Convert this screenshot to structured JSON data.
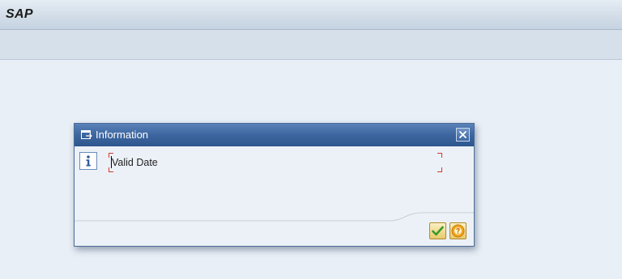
{
  "app": {
    "title": "SAP"
  },
  "dialog": {
    "title": "Information",
    "message": "Valid Date",
    "buttons": {
      "ok_icon": "checkmark-icon",
      "help_icon": "help-icon",
      "close_icon": "close-icon"
    }
  },
  "colors": {
    "header_blue": "#3d66a0",
    "background": "#e9eff6",
    "field_bracket": "#d23a2a",
    "button_gold": "#e9c96a"
  }
}
